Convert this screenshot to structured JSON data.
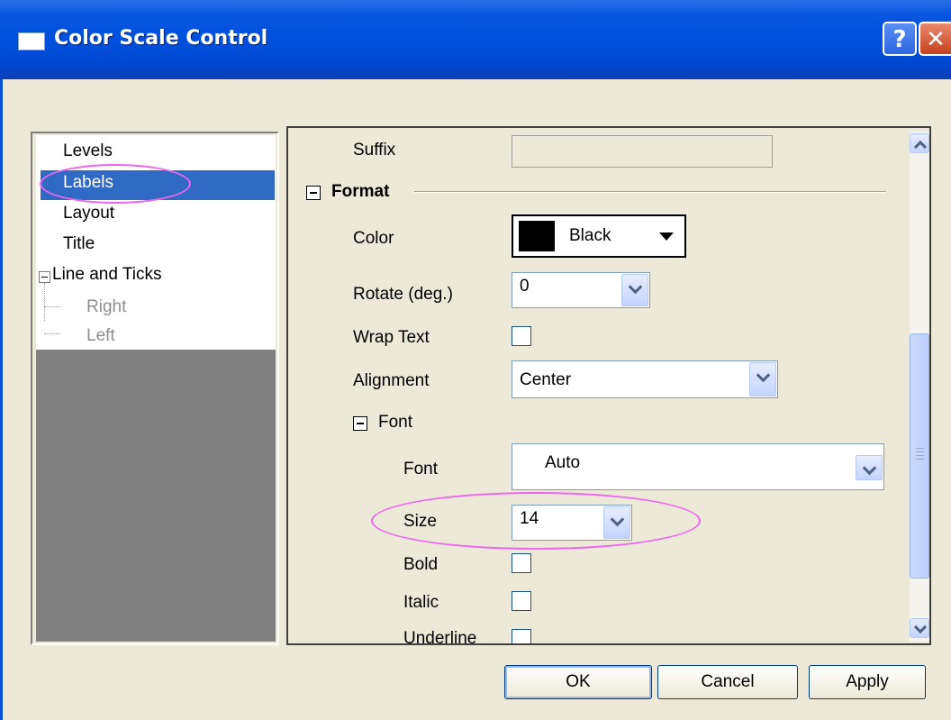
{
  "window": {
    "title": "Color Scale Control",
    "help_label": "?",
    "close_label": "✕"
  },
  "tree": {
    "items": [
      {
        "label": "Levels"
      },
      {
        "label": "Labels"
      },
      {
        "label": "Layout"
      },
      {
        "label": "Title"
      },
      {
        "label": "Line and Ticks"
      },
      {
        "label": "Right"
      },
      {
        "label": "Left"
      }
    ],
    "selected": "Labels"
  },
  "props": {
    "suffix_label": "Suffix",
    "suffix_value": "",
    "format_header": "Format",
    "color_label": "Color",
    "color_value": "Black",
    "rotate_label": "Rotate (deg.)",
    "rotate_value": "0",
    "wrap_label": "Wrap Text",
    "alignment_label": "Alignment",
    "alignment_value": "Center",
    "font_header": "Font",
    "font_label": "Font",
    "font_value": "Auto",
    "size_label": "Size",
    "size_value": "14",
    "bold_label": "Bold",
    "italic_label": "Italic",
    "underline_label": "Underline"
  },
  "buttons": {
    "ok": "OK",
    "cancel": "Cancel",
    "apply": "Apply"
  },
  "colors": {
    "title_bar": "#0050de",
    "selection": "#316ac5",
    "highlight_oval": "#ee66ee",
    "dialog_bg": "#ece9d8"
  }
}
